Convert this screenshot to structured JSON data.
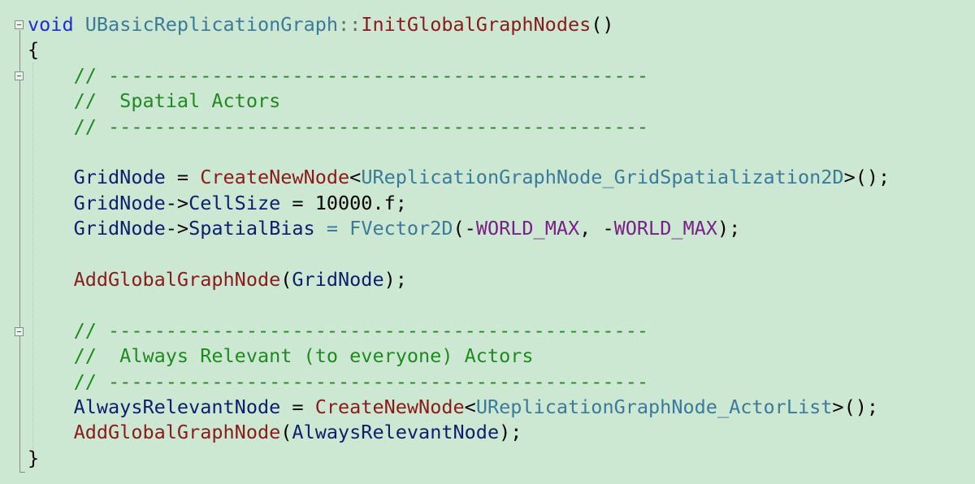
{
  "colors": {
    "background": "#cde8d2",
    "keyword": "#1f2fcc",
    "class_type": "#3a7a9a",
    "function": "#8b1a1a",
    "variable": "#0c1f6e",
    "macro": "#7a1f8a",
    "comment": "#1f8a1f",
    "plain": "#000000"
  },
  "lines": [
    {
      "tokens": [
        {
          "t": "void",
          "k": "keyword"
        },
        {
          "t": " ",
          "k": "plain"
        },
        {
          "t": "UBasicReplicationGraph",
          "k": "class_type"
        },
        {
          "t": "::",
          "k": "plain_gray"
        },
        {
          "t": "InitGlobalGraphNodes",
          "k": "function"
        },
        {
          "t": "()",
          "k": "plain"
        }
      ]
    },
    {
      "tokens": [
        {
          "t": "{",
          "k": "plain"
        }
      ]
    },
    {
      "tokens": [
        {
          "t": "    // -----------------------------------------------",
          "k": "comment"
        }
      ]
    },
    {
      "tokens": [
        {
          "t": "    //  Spatial Actors",
          "k": "comment"
        }
      ]
    },
    {
      "tokens": [
        {
          "t": "    // -----------------------------------------------",
          "k": "comment"
        }
      ]
    },
    {
      "tokens": []
    },
    {
      "tokens": [
        {
          "t": "    ",
          "k": "plain"
        },
        {
          "t": "GridNode",
          "k": "variable"
        },
        {
          "t": " = ",
          "k": "plain"
        },
        {
          "t": "CreateNewNode",
          "k": "function"
        },
        {
          "t": "<",
          "k": "plain"
        },
        {
          "t": "UReplicationGraphNode_GridSpatialization2D",
          "k": "class_type"
        },
        {
          "t": ">();",
          "k": "plain"
        }
      ]
    },
    {
      "tokens": [
        {
          "t": "    ",
          "k": "plain"
        },
        {
          "t": "GridNode",
          "k": "variable"
        },
        {
          "t": "->",
          "k": "plain"
        },
        {
          "t": "CellSize",
          "k": "variable"
        },
        {
          "t": " = 10000.f;",
          "k": "plain"
        }
      ]
    },
    {
      "tokens": [
        {
          "t": "    ",
          "k": "plain"
        },
        {
          "t": "GridNode",
          "k": "variable"
        },
        {
          "t": "->",
          "k": "plain"
        },
        {
          "t": "SpatialBias",
          "k": "variable"
        },
        {
          "t": " = ",
          "k": "class_type"
        },
        {
          "t": "FVector2D",
          "k": "class_type"
        },
        {
          "t": "(-",
          "k": "plain"
        },
        {
          "t": "WORLD_MAX",
          "k": "macro"
        },
        {
          "t": ", -",
          "k": "plain"
        },
        {
          "t": "WORLD_MAX",
          "k": "macro"
        },
        {
          "t": ");",
          "k": "plain"
        }
      ]
    },
    {
      "tokens": []
    },
    {
      "tokens": [
        {
          "t": "    ",
          "k": "plain"
        },
        {
          "t": "AddGlobalGraphNode",
          "k": "function"
        },
        {
          "t": "(",
          "k": "plain"
        },
        {
          "t": "GridNode",
          "k": "variable"
        },
        {
          "t": ");",
          "k": "plain"
        }
      ]
    },
    {
      "tokens": []
    },
    {
      "tokens": [
        {
          "t": "    // -----------------------------------------------",
          "k": "comment"
        }
      ]
    },
    {
      "tokens": [
        {
          "t": "    //  Always Relevant (to everyone) Actors",
          "k": "comment"
        }
      ]
    },
    {
      "tokens": [
        {
          "t": "    // -----------------------------------------------",
          "k": "comment"
        }
      ]
    },
    {
      "tokens": [
        {
          "t": "    ",
          "k": "plain"
        },
        {
          "t": "AlwaysRelevantNode",
          "k": "variable"
        },
        {
          "t": " = ",
          "k": "plain"
        },
        {
          "t": "CreateNewNode",
          "k": "function"
        },
        {
          "t": "<",
          "k": "plain"
        },
        {
          "t": "UReplicationGraphNode_ActorList",
          "k": "class_type"
        },
        {
          "t": ">();",
          "k": "plain"
        }
      ]
    },
    {
      "tokens": [
        {
          "t": "    ",
          "k": "plain"
        },
        {
          "t": "AddGlobalGraphNode",
          "k": "function"
        },
        {
          "t": "(",
          "k": "plain"
        },
        {
          "t": "AlwaysRelevantNode",
          "k": "variable"
        },
        {
          "t": ");",
          "k": "plain"
        }
      ]
    },
    {
      "tokens": [
        {
          "t": "}",
          "k": "plain"
        }
      ]
    }
  ]
}
